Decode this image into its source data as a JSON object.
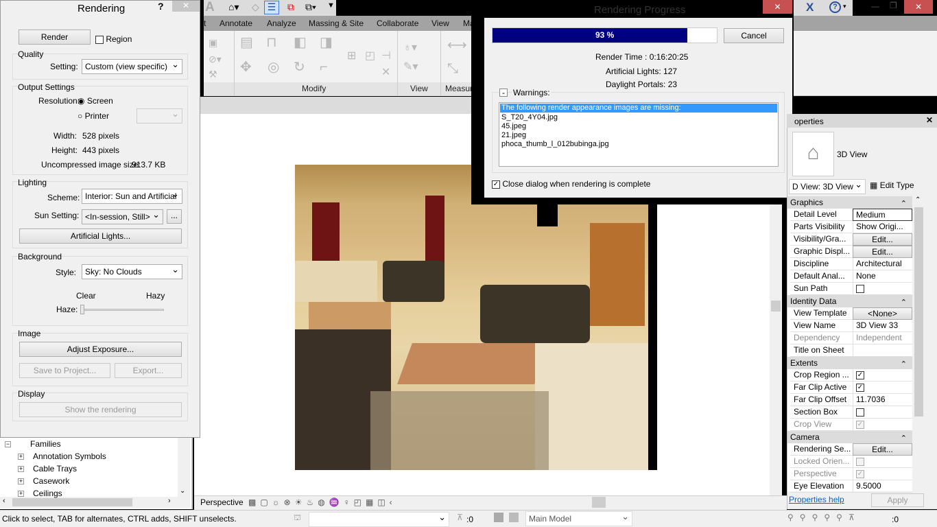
{
  "qat": {
    "icons": [
      "revit-logo-icon",
      "home-3d-icon",
      "sync-icon",
      "thin-lines-icon",
      "close-hidden-windows-icon",
      "switch-windows-icon",
      "customize-icon"
    ]
  },
  "ribbon": {
    "tabs": [
      "t",
      "Annotate",
      "Analyze",
      "Massing & Site",
      "Collaborate",
      "View",
      "Man"
    ],
    "panels": [
      "Modify",
      "View",
      "Measure"
    ]
  },
  "window": {
    "icons": [
      "exchange-x-icon",
      "help-icon"
    ]
  },
  "rendering": {
    "title": "Rendering",
    "help": "?",
    "render": "Render",
    "region": "Region",
    "quality_label": "Quality",
    "setting_label": "Setting:",
    "setting_value": "Custom (view specific)",
    "output_label": "Output Settings",
    "resolution_label": "Resolution:",
    "screen": "Screen",
    "printer": "Printer",
    "width_label": "Width:",
    "width_value": "528 pixels",
    "height_label": "Height:",
    "height_value": "443 pixels",
    "size_label": "Uncompressed image size:",
    "size_value": "913.7 KB",
    "lighting_label": "Lighting",
    "scheme_label": "Scheme:",
    "scheme_value": "Interior: Sun and Artificial",
    "sun_label": "Sun Setting:",
    "sun_value": "<In-session, Still>",
    "sun_more": "...",
    "artificial": "Artificial Lights...",
    "background_label": "Background",
    "style_label": "Style:",
    "style_value": "Sky: No Clouds",
    "clear": "Clear",
    "hazy": "Hazy",
    "haze_label": "Haze:",
    "haze_value": 0,
    "image_label": "Image",
    "adjust": "Adjust Exposure...",
    "save": "Save to Project...",
    "export": "Export...",
    "display_label": "Display",
    "show": "Show the rendering"
  },
  "browser": {
    "items": [
      "Families",
      "Annotation Symbols",
      "Cable Trays",
      "Casework",
      "Ceilings"
    ]
  },
  "progress": {
    "title": "Rendering Progress",
    "percent_text": "93 %",
    "percent": 93,
    "cancel": "Cancel",
    "render_time": "Render Time : 0:16:20:25",
    "lights": "Artificial Lights: 127",
    "portals": "Daylight Portals: 23",
    "warnings_toggle": "-",
    "warnings_label": "Warnings:",
    "warnings": [
      "The following render appearance images are missing:",
      "S_T20_4Y04.jpg",
      "45.jpeg",
      "21.jpeg",
      "phoca_thumb_l_012bubinga.jpg"
    ],
    "close_when_done": "Close dialog when rendering is complete",
    "close_checked": true
  },
  "properties": {
    "title": "operties",
    "type_name": "3D View",
    "view_selector": "D View: 3D View",
    "edit_type": "Edit Type",
    "categories": {
      "graphics": "Graphics",
      "identity": "Identity Data",
      "extents": "Extents",
      "camera": "Camera"
    },
    "graphics": [
      [
        "Detail Level",
        "Medium"
      ],
      [
        "Parts Visibility",
        "Show Origi..."
      ],
      [
        "Visibility/Gra...",
        "Edit..."
      ],
      [
        "Graphic Displ...",
        "Edit..."
      ],
      [
        "Discipline",
        "Architectural"
      ],
      [
        "Default Anal...",
        "None"
      ],
      [
        "Sun Path",
        ""
      ]
    ],
    "identity": [
      [
        "View Template",
        "<None>"
      ],
      [
        "View Name",
        "3D View 33"
      ],
      [
        "Dependency",
        "Independent"
      ],
      [
        "Title on Sheet",
        ""
      ]
    ],
    "extents": [
      [
        "Crop Region ...",
        "✓"
      ],
      [
        "Far Clip Active",
        "✓"
      ],
      [
        "Far Clip Offset",
        "11.7036"
      ],
      [
        "Section Box",
        ""
      ],
      [
        "Crop View",
        "✓"
      ]
    ],
    "camera": [
      [
        "Rendering Se...",
        "Edit..."
      ],
      [
        "Locked Orien...",
        ""
      ],
      [
        "Perspective",
        "✓"
      ],
      [
        "Eye Elevation",
        "9.5000"
      ]
    ],
    "help": "Properties help",
    "apply": "Apply"
  },
  "viewbar": {
    "mode": "Perspective"
  },
  "status": {
    "text": "Click to select, TAB for alternates, CTRL adds, SHIFT unselects.",
    "filter_count": ":0",
    "model": "Main Model"
  }
}
